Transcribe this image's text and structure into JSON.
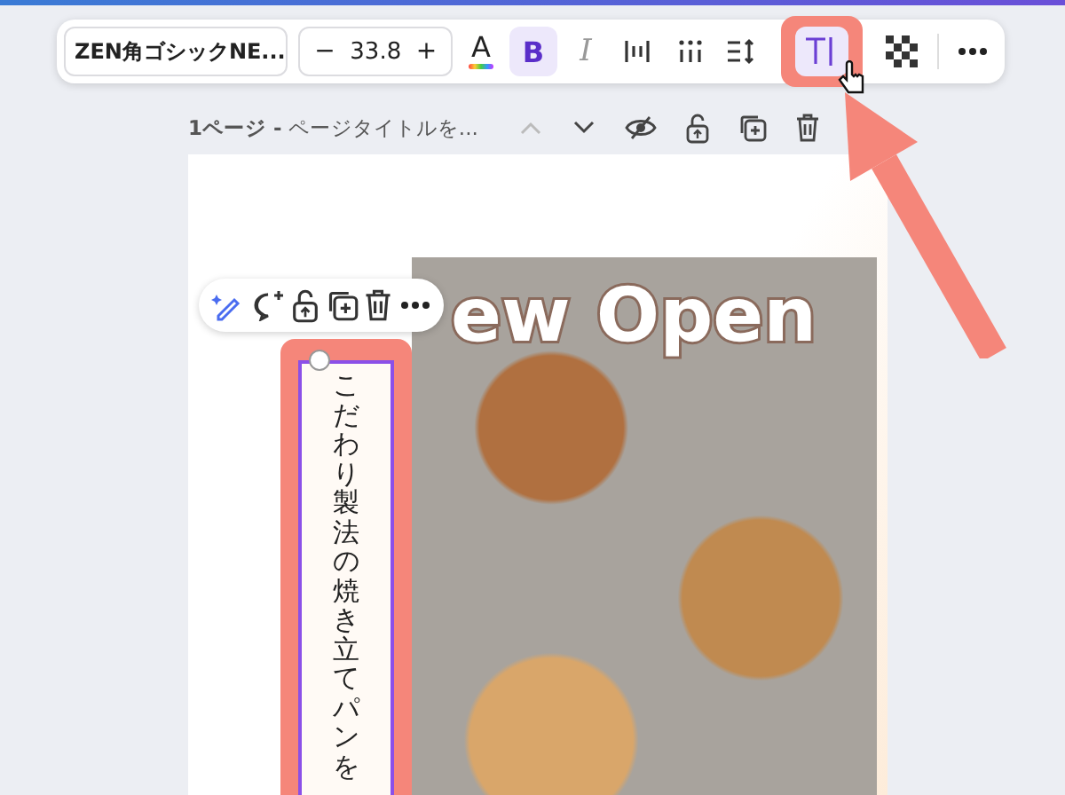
{
  "toolbar": {
    "font": "ZEN角ゴシックNE...",
    "minus": "−",
    "size": "33.8",
    "plus": "+",
    "buttons": [
      {
        "kind": "text-color",
        "label": "A",
        "selected": false
      },
      {
        "kind": "bold",
        "label": "B",
        "selected": true
      },
      {
        "kind": "italic",
        "label": "I",
        "selected": false
      },
      {
        "kind": "letter-spacing",
        "selected": false
      },
      {
        "kind": "list",
        "selected": false
      },
      {
        "kind": "line-spacing",
        "selected": false
      },
      {
        "kind": "vertical-text",
        "selected": true
      },
      {
        "kind": "transparency",
        "selected": false
      },
      {
        "kind": "more",
        "selected": false
      }
    ]
  },
  "page_header": {
    "title": "**1ページ -** ページタイトルを..."
  },
  "canvas": {
    "heading": "ew Open",
    "vertical_text": {
      "text": "こだわり製法の焼き立てパンを",
      "selected": true
    }
  }
}
